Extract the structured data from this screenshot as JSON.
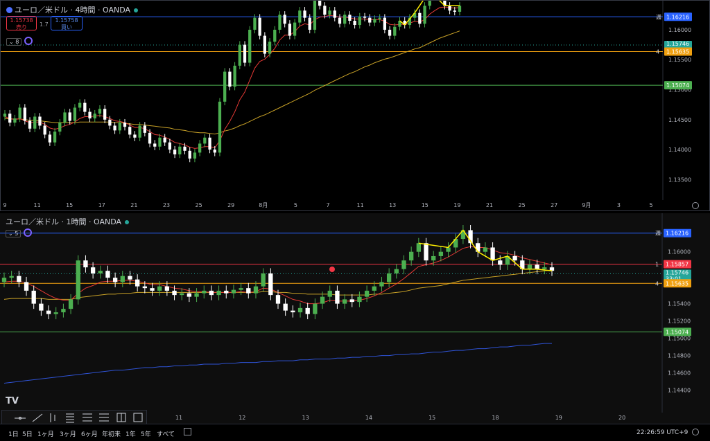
{
  "pane1": {
    "title": "ユーロ／米ドル · 4時間 · OANDA",
    "sell_price": "1.15738",
    "sell_label": "売り",
    "buy_price": "1.15758",
    "buy_label": "買い",
    "spread": "1.7",
    "indicator_count": "8"
  },
  "pane2": {
    "title": "ユーロ／米ドル · 1時間 · OANDA",
    "indicator_count": "5"
  },
  "bottom_bar": {
    "ranges": [
      "1日",
      "5日",
      "1ヶ月",
      "3ヶ月",
      "6ヶ月",
      "年初来",
      "1年",
      "5年",
      "すべて"
    ],
    "clock": "22:26:59 UTC+9"
  },
  "colors": {
    "up": "#26a69a",
    "up_candle": "#4caf50",
    "down": "#ffffff",
    "hline_blue": "#2962ff",
    "hline_orange": "#f0a010",
    "hline_green": "#4caf50",
    "hline_red": "#f23645",
    "ma_red": "#e53935",
    "ma_yellow": "#c9a227",
    "ma_blue": "#2f53d6",
    "zigzag": "#ffee00"
  },
  "chart_data": [
    {
      "type": "candlestick",
      "timeframe": "4時間",
      "ylim": [
        1.1325,
        1.163
      ],
      "yticks": [
        "1.16000",
        "1.15500",
        "1.15000",
        "1.14500",
        "1.14000",
        "1.13500"
      ],
      "xticks": [
        "9",
        "11",
        "15",
        "17",
        "21",
        "23",
        "25",
        "29",
        "8月",
        "5",
        "7",
        "11",
        "13",
        "15",
        "19",
        "21",
        "25",
        "27",
        "9月",
        "3",
        "5"
      ],
      "hlines": [
        {
          "label": "1.16216",
          "value": 1.16216,
          "role": "blue",
          "tag": "週"
        },
        {
          "label": "1.15746",
          "value": 1.15746,
          "role": "last",
          "countdown": "03:33:01"
        },
        {
          "label": "1.15635",
          "value": 1.15635,
          "role": "orange",
          "tag": "4"
        },
        {
          "label": "1.15074",
          "value": 1.15074,
          "role": "green"
        }
      ],
      "closes": [
        1.146,
        1.1445,
        1.1452,
        1.147,
        1.1448,
        1.1435,
        1.1455,
        1.144,
        1.1425,
        1.1412,
        1.143,
        1.1445,
        1.1462,
        1.1448,
        1.147,
        1.1478,
        1.1463,
        1.1452,
        1.146,
        1.1468,
        1.145,
        1.144,
        1.1432,
        1.1445,
        1.1438,
        1.1425,
        1.142,
        1.144,
        1.1428,
        1.141,
        1.1405,
        1.142,
        1.1412,
        1.14,
        1.1392,
        1.1405,
        1.1398,
        1.1385,
        1.1395,
        1.141,
        1.142,
        1.14,
        1.1395,
        1.148,
        1.153,
        1.1505,
        1.154,
        1.1575,
        1.1545,
        1.16,
        1.162,
        1.159,
        1.156,
        1.158,
        1.16,
        1.1625,
        1.161,
        1.159,
        1.1612,
        1.1632,
        1.162,
        1.16,
        1.165,
        1.164,
        1.1625,
        1.1632,
        1.162,
        1.161,
        1.1625,
        1.1615,
        1.1608,
        1.1622,
        1.162,
        1.1612,
        1.1618,
        1.162,
        1.16,
        1.159,
        1.1605,
        1.1615,
        1.1608,
        1.162,
        1.1628,
        1.161,
        1.164,
        1.1665,
        1.1655,
        1.166,
        1.164,
        1.1632,
        1.163,
        1.164
      ],
      "ma_short": [
        1.1455,
        1.1452,
        1.145,
        1.1452,
        1.1448,
        1.1445,
        1.1446,
        1.1446,
        1.1442,
        1.1436,
        1.1434,
        1.1436,
        1.144,
        1.1442,
        1.1446,
        1.1452,
        1.1455,
        1.1455,
        1.1456,
        1.1457,
        1.1455,
        1.1452,
        1.1448,
        1.1447,
        1.1445,
        1.1441,
        1.1437,
        1.1437,
        1.1435,
        1.143,
        1.1425,
        1.1424,
        1.1421,
        1.1417,
        1.1412,
        1.141,
        1.1408,
        1.1404,
        1.1402,
        1.1403,
        1.1405,
        1.1405,
        1.1403,
        1.1415,
        1.1434,
        1.1447,
        1.1463,
        1.1483,
        1.1496,
        1.1516,
        1.1536,
        1.1547,
        1.1551,
        1.1559,
        1.1569,
        1.1583,
        1.1591,
        1.1591,
        1.1597,
        1.1606,
        1.161,
        1.1608,
        1.1617,
        1.1621,
        1.1622,
        1.1624,
        1.1623,
        1.1621,
        1.1621,
        1.162,
        1.1618,
        1.1618,
        1.1618,
        1.1617,
        1.1617,
        1.1617,
        1.1614,
        1.1609,
        1.1608,
        1.1609,
        1.1609,
        1.1611,
        1.1614,
        1.1613,
        1.1617,
        1.1626,
        1.1632,
        1.1637,
        1.1638,
        1.1637,
        1.1636,
        1.1637
      ],
      "ma_long": [
        1.1452,
        1.1451,
        1.1451,
        1.1451,
        1.145,
        1.1449,
        1.1449,
        1.1448,
        1.1447,
        1.1446,
        1.1445,
        1.1445,
        1.1445,
        1.1445,
        1.1445,
        1.1446,
        1.1446,
        1.1446,
        1.1446,
        1.1446,
        1.1446,
        1.1446,
        1.1445,
        1.1445,
        1.1444,
        1.1443,
        1.1442,
        1.1442,
        1.1441,
        1.144,
        1.1439,
        1.1438,
        1.1437,
        1.1436,
        1.1434,
        1.1433,
        1.1432,
        1.143,
        1.1429,
        1.1428,
        1.1428,
        1.1427,
        1.1426,
        1.1428,
        1.1431,
        1.1433,
        1.1436,
        1.144,
        1.1443,
        1.1447,
        1.1451,
        1.1455,
        1.1458,
        1.1462,
        1.1466,
        1.147,
        1.1474,
        1.1478,
        1.1482,
        1.1486,
        1.149,
        1.1494,
        1.1499,
        1.1503,
        1.1507,
        1.1511,
        1.1515,
        1.1519,
        1.1523,
        1.1527,
        1.153,
        1.1534,
        1.1538,
        1.1541,
        1.1545,
        1.1548,
        1.1551,
        1.1553,
        1.1556,
        1.1559,
        1.1562,
        1.1565,
        1.1568,
        1.157,
        1.1574,
        1.1578,
        1.1582,
        1.1586,
        1.1589,
        1.1592,
        1.1595,
        1.1598
      ]
    },
    {
      "type": "candlestick",
      "timeframe": "1時間",
      "ylim": [
        1.143,
        1.1635
      ],
      "yticks": [
        "1.16000",
        "1.15400",
        "1.15200",
        "1.15000",
        "1.14800",
        "1.14600",
        "1.14400"
      ],
      "xticks": [
        "11",
        "12",
        "13",
        "14",
        "15",
        "18",
        "19",
        "20"
      ],
      "hlines": [
        {
          "label": "1.16216",
          "value": 1.16216,
          "role": "blue",
          "tag": "週"
        },
        {
          "label": "1.15857",
          "value": 1.15857,
          "role": "red",
          "tag": "1"
        },
        {
          "label": "1.15746",
          "value": 1.15746,
          "role": "last",
          "countdown": "33:01"
        },
        {
          "label": "1.15635",
          "value": 1.15635,
          "role": "orange",
          "tag": "4"
        },
        {
          "label": "1.15074",
          "value": 1.15074,
          "role": "green"
        }
      ],
      "closes": [
        1.157,
        1.1572,
        1.1565,
        1.1555,
        1.154,
        1.1532,
        1.1528,
        1.153,
        1.1534,
        1.1545,
        1.159,
        1.1582,
        1.1575,
        1.1578,
        1.157,
        1.1565,
        1.1572,
        1.1568,
        1.156,
        1.1558,
        1.1555,
        1.156,
        1.1555,
        1.155,
        1.1552,
        1.1548,
        1.1552,
        1.1555,
        1.155,
        1.1555,
        1.1552,
        1.1556,
        1.1558,
        1.1552,
        1.156,
        1.1575,
        1.155,
        1.154,
        1.1532,
        1.153,
        1.1535,
        1.1528,
        1.154,
        1.1548,
        1.1555,
        1.154,
        1.1545,
        1.1542,
        1.1548,
        1.1555,
        1.156,
        1.1565,
        1.1575,
        1.158,
        1.159,
        1.16,
        1.161,
        1.159,
        1.1595,
        1.16,
        1.1605,
        1.1615,
        1.1625,
        1.161,
        1.16,
        1.1605,
        1.159,
        1.1585,
        1.1595,
        1.159,
        1.158,
        1.1585,
        1.158,
        1.1582,
        1.1578
      ],
      "ma_short": [
        1.1565,
        1.1566,
        1.1566,
        1.1564,
        1.156,
        1.1555,
        1.155,
        1.1546,
        1.1544,
        1.1544,
        1.1552,
        1.1558,
        1.1561,
        1.1565,
        1.1566,
        1.1566,
        1.1567,
        1.1567,
        1.1566,
        1.1564,
        1.1562,
        1.1562,
        1.156,
        1.1558,
        1.1557,
        1.1555,
        1.1554,
        1.1554,
        1.1553,
        1.1553,
        1.1553,
        1.1553,
        1.1554,
        1.1553,
        1.1554,
        1.1558,
        1.1557,
        1.1553,
        1.1549,
        1.1545,
        1.1543,
        1.154,
        1.154,
        1.1541,
        1.1544,
        1.1543,
        1.1543,
        1.1543,
        1.1544,
        1.1546,
        1.1549,
        1.1553,
        1.1558,
        1.1563,
        1.1569,
        1.1576,
        1.1583,
        1.1585,
        1.1587,
        1.159,
        1.1594,
        1.1599,
        1.1604,
        1.1606,
        1.1605,
        1.1605,
        1.1602,
        1.1599,
        1.1598,
        1.1596,
        1.1593,
        1.1591,
        1.1589,
        1.1587,
        1.1585
      ],
      "ma_mid": [
        1.1545,
        1.1546,
        1.1546,
        1.1546,
        1.1546,
        1.1546,
        1.1545,
        1.1545,
        1.1545,
        1.1545,
        1.1547,
        1.1548,
        1.1549,
        1.155,
        1.1551,
        1.1551,
        1.1552,
        1.1552,
        1.1553,
        1.1553,
        1.1553,
        1.1553,
        1.1553,
        1.1553,
        1.1553,
        1.1553,
        1.1553,
        1.1553,
        1.1553,
        1.1553,
        1.1553,
        1.1553,
        1.1553,
        1.1553,
        1.1553,
        1.1554,
        1.1554,
        1.1553,
        1.1553,
        1.1552,
        1.1552,
        1.1551,
        1.1551,
        1.1551,
        1.1551,
        1.155,
        1.155,
        1.155,
        1.155,
        1.155,
        1.1551,
        1.1551,
        1.1552,
        1.1553,
        1.1554,
        1.1556,
        1.1558,
        1.1559,
        1.156,
        1.1561,
        1.1563,
        1.1565,
        1.1567,
        1.1568,
        1.1569,
        1.157,
        1.1571,
        1.1572,
        1.1573,
        1.1574,
        1.1575,
        1.1576,
        1.1577,
        1.1578,
        1.1579
      ],
      "ma_long": [
        1.1448,
        1.1449,
        1.145,
        1.1451,
        1.1452,
        1.1453,
        1.1454,
        1.1455,
        1.1456,
        1.1457,
        1.1458,
        1.1459,
        1.146,
        1.1461,
        1.1462,
        1.1463,
        1.1463,
        1.1464,
        1.1465,
        1.1466,
        1.1466,
        1.1467,
        1.1467,
        1.1468,
        1.1468,
        1.1469,
        1.1469,
        1.147,
        1.147,
        1.147,
        1.1471,
        1.1471,
        1.1472,
        1.1472,
        1.1472,
        1.1473,
        1.1473,
        1.1474,
        1.1474,
        1.1474,
        1.1475,
        1.1475,
        1.1476,
        1.1476,
        1.1476,
        1.1477,
        1.1477,
        1.1478,
        1.1478,
        1.1479,
        1.1479,
        1.148,
        1.148,
        1.1481,
        1.1481,
        1.1482,
        1.1482,
        1.1483,
        1.1484,
        1.1484,
        1.1485,
        1.1486,
        1.1486,
        1.1487,
        1.1488,
        1.1488,
        1.1489,
        1.149,
        1.149,
        1.1491,
        1.1492,
        1.1492,
        1.1493,
        1.1494,
        1.1494
      ]
    }
  ]
}
